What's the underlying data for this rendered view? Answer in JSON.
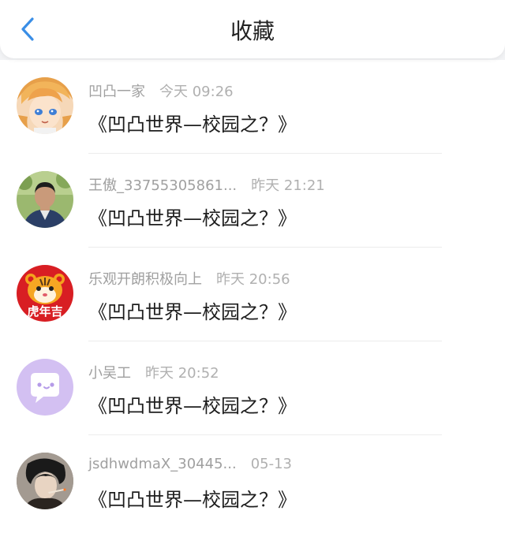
{
  "header": {
    "title": "收藏",
    "back_icon": "chevron-left-icon",
    "accent": "#3a8ee6"
  },
  "items": [
    {
      "user": "凹凸一家",
      "time": "今天 09:26",
      "content": "《凹凸世界—校园之？》"
    },
    {
      "user": "王傲_33755305861...",
      "time": "昨天 21:21",
      "content": "《凹凸世界—校园之？》"
    },
    {
      "user": "乐观开朗积极向上",
      "time": "昨天 20:56",
      "content": "《凹凸世界—校园之？》"
    },
    {
      "user": "小吴工",
      "time": "昨天 20:52",
      "content": "《凹凸世界—校园之？》"
    },
    {
      "user": "jsdhwdmaX_30445...",
      "time": "05-13",
      "content": "《凹凸世界—校园之？》"
    }
  ],
  "avatars": {
    "tiger_badge": "虎年吉"
  }
}
